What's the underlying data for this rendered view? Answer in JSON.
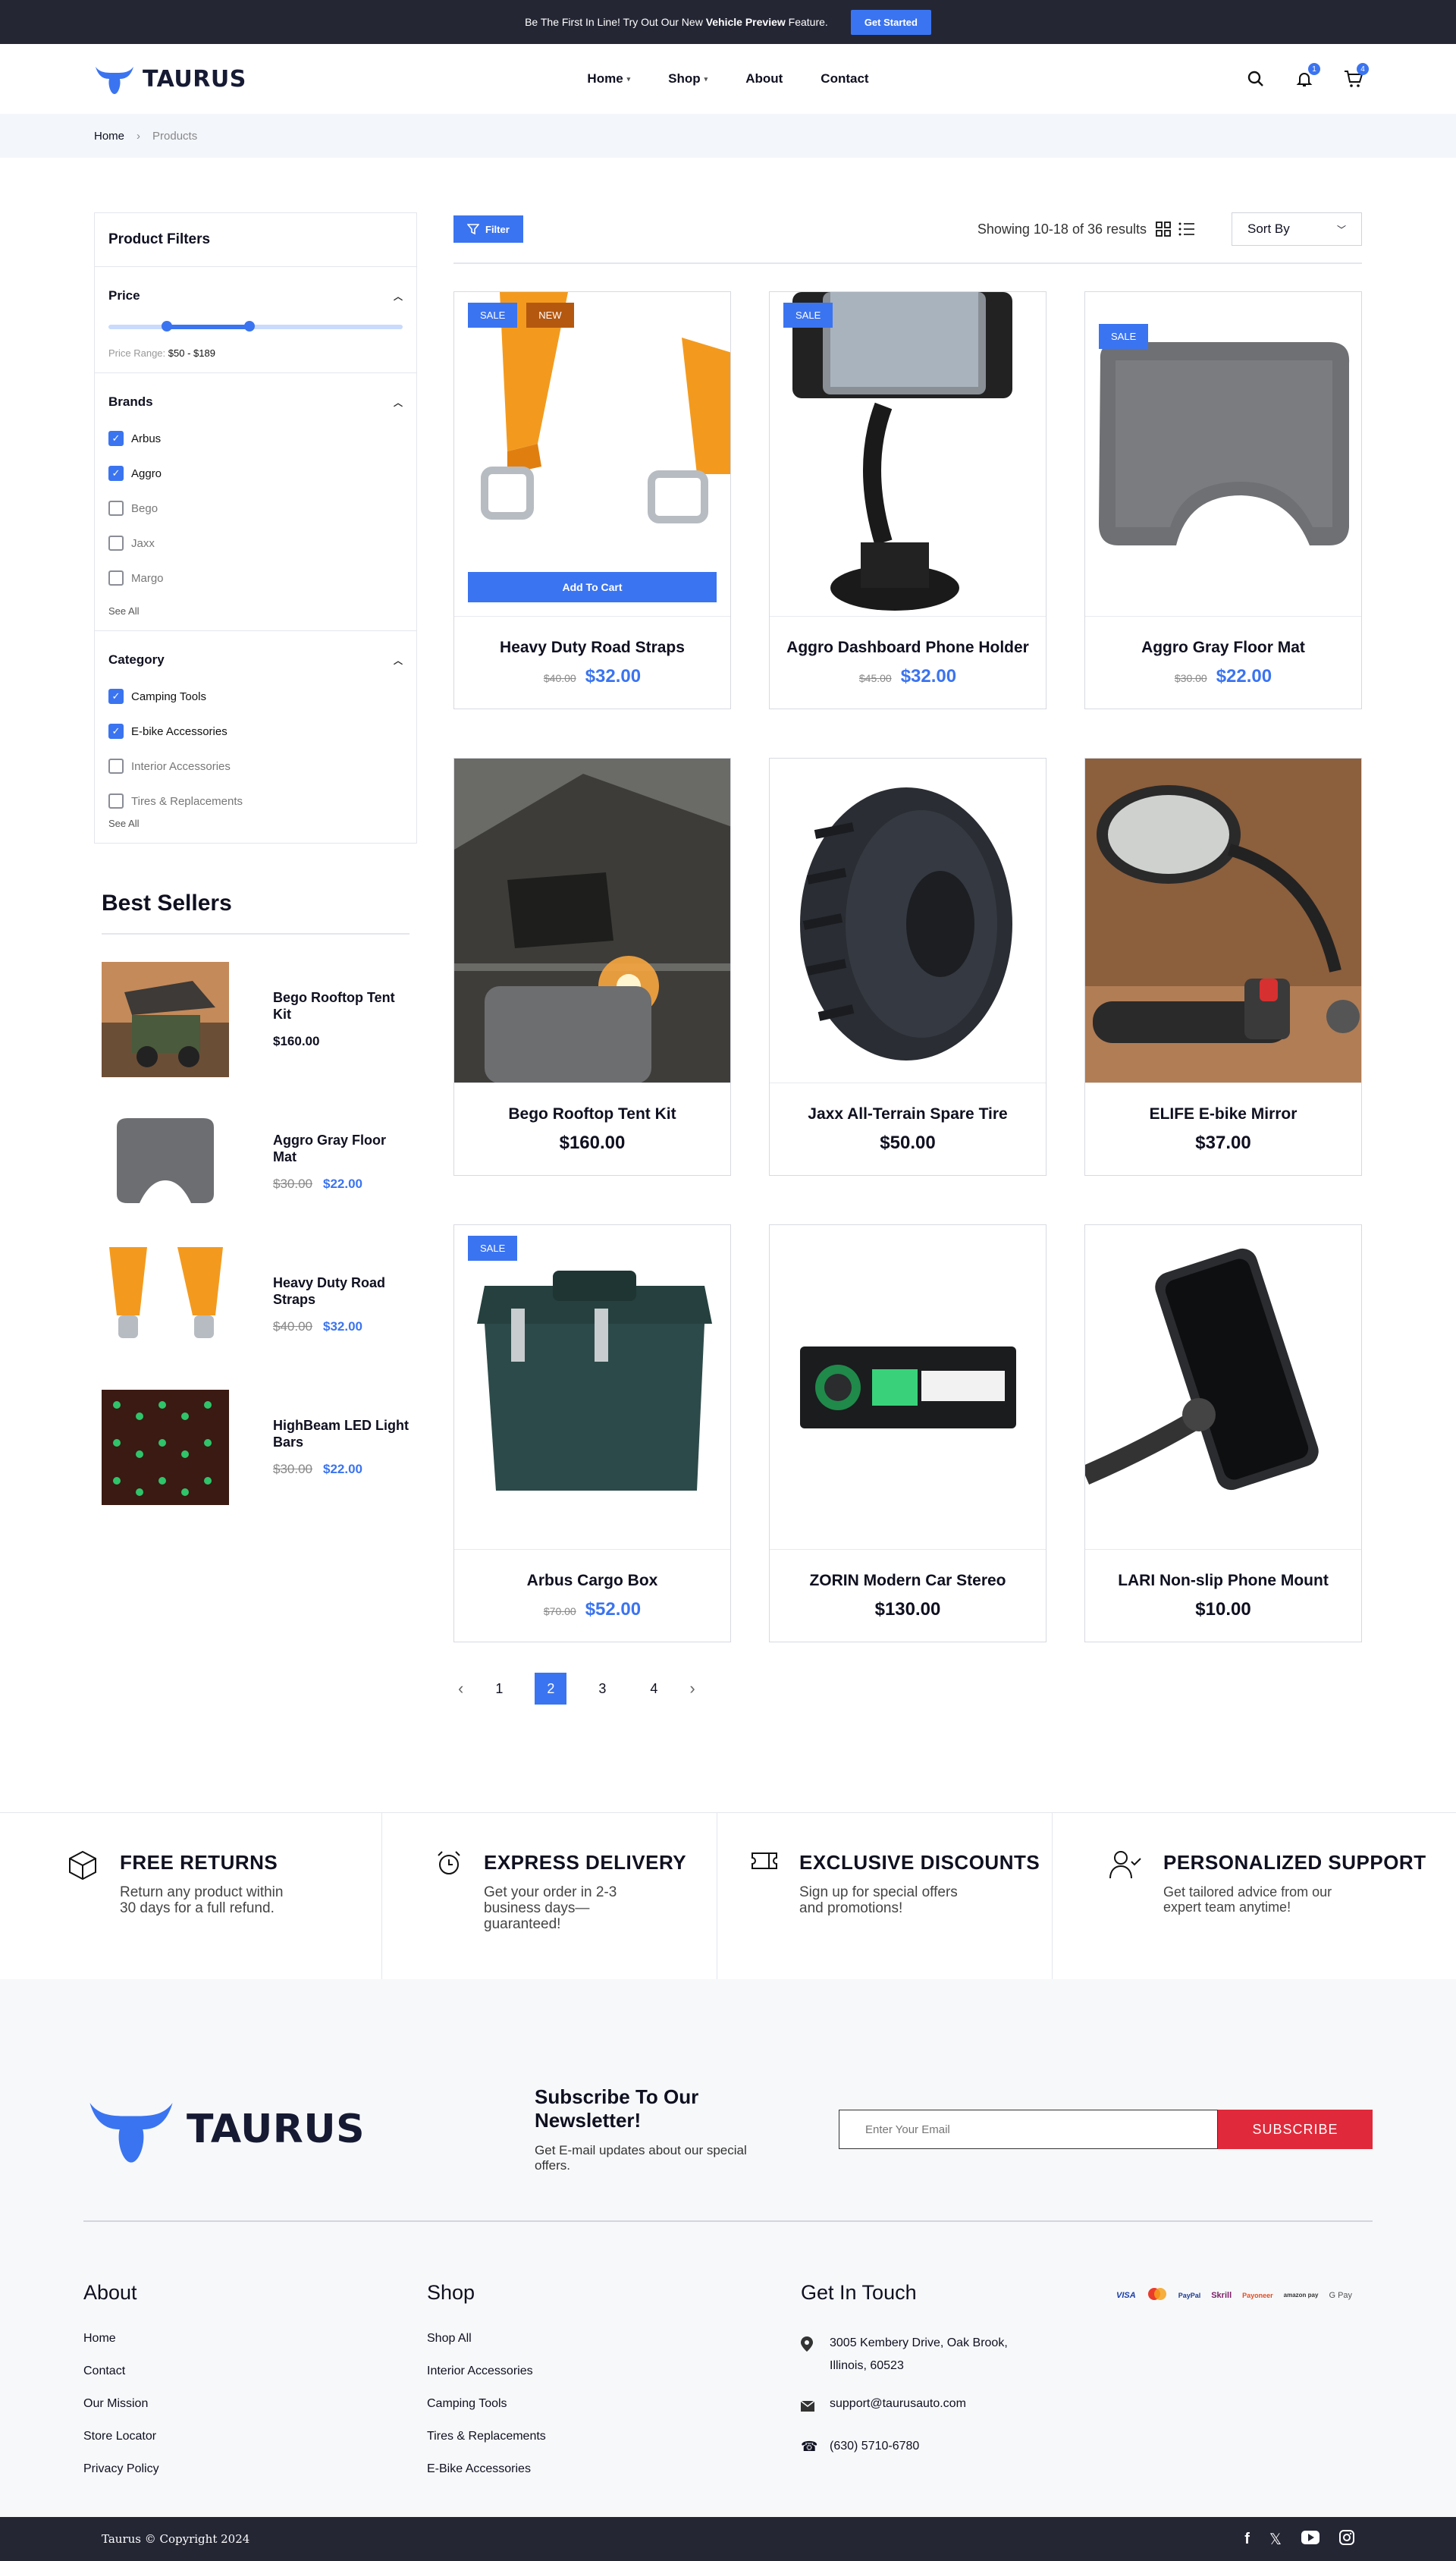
{
  "announcement": {
    "prefix": "Be The First In Line! Try Out Our New",
    "highlight": "Vehicle Preview",
    "suffix": "Feature.",
    "cta": "Get Started"
  },
  "brand": {
    "name": "TAURUS",
    "accent": "#3b74f0",
    "sale_color": "#e0293a"
  },
  "nav": {
    "items": [
      {
        "label": "Home",
        "dropdown": true
      },
      {
        "label": "Shop",
        "dropdown": true
      },
      {
        "label": "About",
        "dropdown": false
      },
      {
        "label": "Contact",
        "dropdown": false
      }
    ]
  },
  "header_icons": {
    "notifications_count": "1",
    "cart_count": "4"
  },
  "breadcrumb": [
    "Home",
    "Products"
  ],
  "filters": {
    "title": "Product Filters",
    "price": {
      "title": "Price",
      "range_label": "Price Range:",
      "range_value": "$50 - $189"
    },
    "brands": {
      "title": "Brands",
      "items": [
        {
          "label": "Arbus",
          "checked": true
        },
        {
          "label": "Aggro",
          "checked": true
        },
        {
          "label": "Bego",
          "checked": false
        },
        {
          "label": "Jaxx",
          "checked": false
        },
        {
          "label": "Margo",
          "checked": false
        }
      ],
      "see_all": "See All"
    },
    "category": {
      "title": "Category",
      "items": [
        {
          "label": "Camping Tools",
          "checked": true
        },
        {
          "label": "E-bike Accessories",
          "checked": true
        },
        {
          "label": "Interior Accessories",
          "checked": false
        },
        {
          "label": "Tires & Replacements",
          "checked": false
        }
      ],
      "see_all": "See All"
    }
  },
  "best_sellers": {
    "title": "Best Sellers",
    "items": [
      {
        "name": "Bego Rooftop Tent Kit",
        "price": "$160.00",
        "old_price": null
      },
      {
        "name": "Aggro Gray Floor Mat",
        "price": "$22.00",
        "old_price": "$30.00"
      },
      {
        "name": "Heavy Duty Road Straps",
        "price": "$32.00",
        "old_price": "$40.00"
      },
      {
        "name": "HighBeam LED Light Bars",
        "price": "$22.00",
        "old_price": "$30.00"
      }
    ]
  },
  "toolbar": {
    "filter_label": "Filter",
    "results": "Showing 10-18 of 36 results",
    "sort_label": "Sort By"
  },
  "products": [
    {
      "name": "Heavy Duty Road Straps",
      "price": "$32.00",
      "old_price": "$40.00",
      "tags": [
        "SALE",
        "NEW"
      ],
      "add_to_cart": "Add To Cart",
      "image": "straps"
    },
    {
      "name": "Aggro Dashboard Phone Holder",
      "price": "$32.00",
      "old_price": "$45.00",
      "tags": [
        "SALE"
      ],
      "image": "phone-holder"
    },
    {
      "name": "Aggro Gray Floor Mat",
      "price": "$22.00",
      "old_price": "$30.00",
      "tags": [
        "SALE"
      ],
      "image": "floor-mat"
    },
    {
      "name": "Bego Rooftop Tent Kit",
      "price": "$160.00",
      "old_price": null,
      "tags": [],
      "image": "tent"
    },
    {
      "name": "Jaxx All-Terrain Spare Tire",
      "price": "$50.00",
      "old_price": null,
      "tags": [],
      "image": "tire"
    },
    {
      "name": "ELIFE E-bike Mirror",
      "price": "$37.00",
      "old_price": null,
      "tags": [],
      "image": "mirror"
    },
    {
      "name": "Arbus Cargo Box",
      "price": "$52.00",
      "old_price": "$70.00",
      "tags": [
        "SALE"
      ],
      "image": "cargo-box"
    },
    {
      "name": "ZORIN Modern Car Stereo",
      "price": "$130.00",
      "old_price": null,
      "tags": [],
      "image": "stereo"
    },
    {
      "name": "LARI Non-slip Phone Mount",
      "price": "$10.00",
      "old_price": null,
      "tags": [],
      "image": "phone-mount"
    }
  ],
  "pagination": {
    "pages": [
      "1",
      "2",
      "3",
      "4"
    ],
    "current": "2"
  },
  "features": [
    {
      "title": "FREE RETURNS",
      "text": "Return any product within 30 days for a full refund.",
      "icon": "box-icon"
    },
    {
      "title": "EXPRESS DELIVERY",
      "text": "Get your order in 2-3 business days—guaranteed!",
      "icon": "alarm-clock-icon"
    },
    {
      "title": "EXCLUSIVE DISCOUNTS",
      "text": "Sign up for special offers and promotions!",
      "icon": "ticket-icon"
    },
    {
      "title": "PERSONALIZED SUPPORT",
      "text": "Get tailored advice from our expert team anytime!",
      "icon": "user-check-icon"
    }
  ],
  "newsletter": {
    "title": "Subscribe To Our Newsletter!",
    "text": "Get E-mail updates about our special offers.",
    "placeholder": "Enter Your Email",
    "button": "SUBSCRIBE"
  },
  "footer": {
    "about": {
      "title": "About",
      "links": [
        "Home",
        "Contact",
        "Our Mission",
        "Store Locator",
        "Privacy Policy"
      ]
    },
    "shop": {
      "title": "Shop",
      "links": [
        "Shop All",
        "Interior Accessories",
        "Camping Tools",
        "Tires & Replacements",
        "E-Bike Accessories"
      ]
    },
    "contact": {
      "title": "Get In Touch",
      "address": "3005 Kembery Drive, Oak Brook, Illinois, 60523",
      "email": "support@taurusauto.com",
      "phone": "(630) 5710-6780"
    },
    "payments": [
      "VISA",
      "Mastercard",
      "PayPal",
      "Skrill",
      "Payoneer",
      "amazon pay",
      "G Pay"
    ],
    "copyright": "Taurus © Copyright 2024"
  }
}
